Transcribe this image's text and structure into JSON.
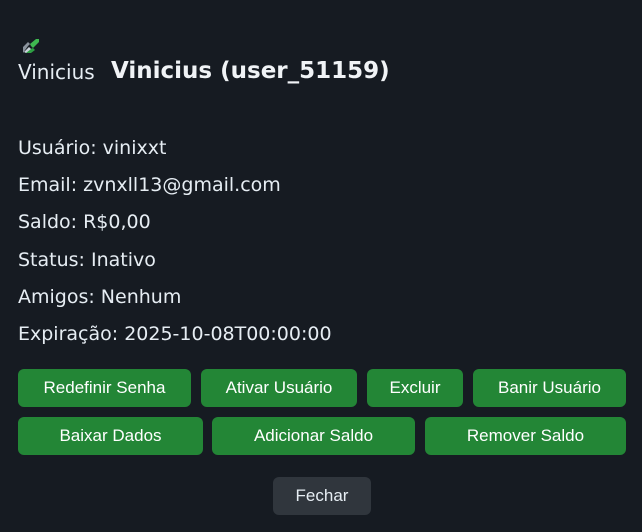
{
  "user_modal": {
    "avatar_alt": "Vinicius",
    "title": "Vinicius (user_51159)",
    "info": {
      "username": "Usuário: vinixxt",
      "email": "Email: zvnxll13@gmail.com",
      "balance": "Saldo: R$0,00",
      "status": "Status: Inativo",
      "friends": "Amigos: Nenhum",
      "expiration": "Expiração: 2025-10-08T00:00:00"
    },
    "actions": {
      "reset_password": "Redefinir Senha",
      "activate_user": "Ativar Usuário",
      "delete": "Excluir",
      "ban_user": "Banir Usuário",
      "download_data": "Baixar Dados",
      "add_balance": "Adicionar Saldo",
      "remove_balance": "Remover Saldo",
      "close": "Fechar"
    },
    "colors": {
      "background": "#161b22",
      "primary_button": "#238636",
      "secondary_button": "#30363d"
    },
    "icons": {
      "avatar": "broken-image-icon"
    }
  }
}
